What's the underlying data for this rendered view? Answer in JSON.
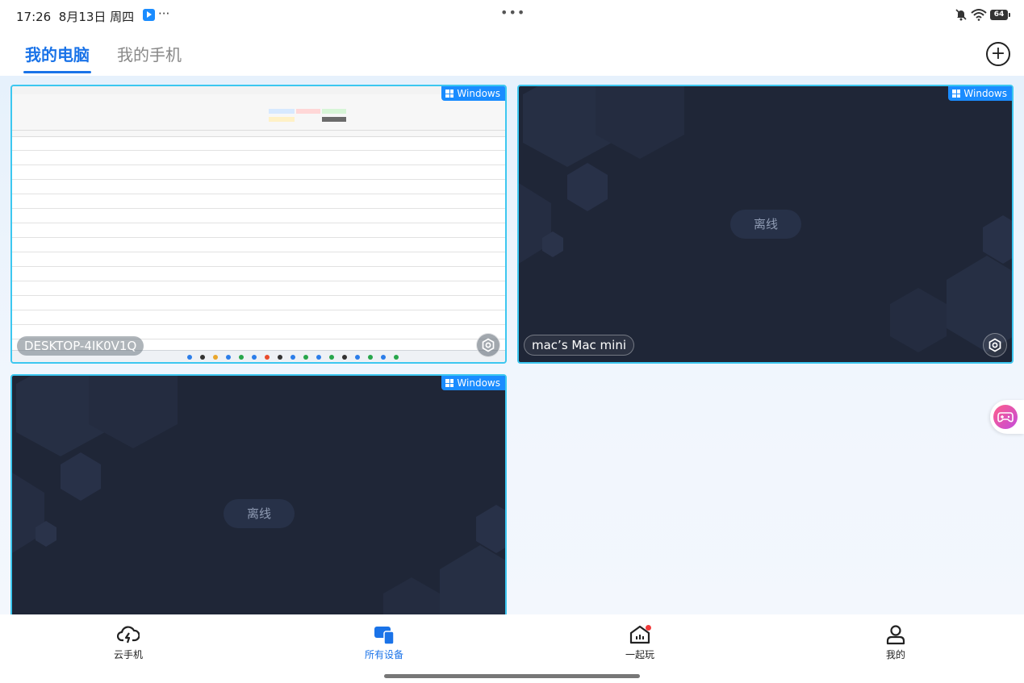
{
  "status_bar": {
    "time": "17:26",
    "date": "8月13日 周四",
    "more": "···",
    "center_dots": "•••",
    "battery": "64"
  },
  "tabs": {
    "my_computer": "我的电脑",
    "my_phone": "我的手机"
  },
  "devices": [
    {
      "os": "Windows",
      "name": "DESKTOP-4IK0V1Q",
      "status": ""
    },
    {
      "os": "Windows",
      "name": "mac’s Mac mini",
      "status": "离线"
    },
    {
      "os": "Windows",
      "name": "",
      "status": "离线"
    }
  ],
  "bottom_nav": [
    {
      "label": "云手机",
      "icon": "cloud-lightning-icon"
    },
    {
      "label": "所有设备",
      "icon": "devices-icon",
      "active": true
    },
    {
      "label": "一起玩",
      "icon": "home-play-icon",
      "badge": true
    },
    {
      "label": "我的",
      "icon": "user-icon"
    }
  ],
  "colors": {
    "accent": "#1a73e8",
    "card_border": "#3cc7f0",
    "badge_blue": "#1a8cff",
    "card_dark": "#1f2637"
  }
}
